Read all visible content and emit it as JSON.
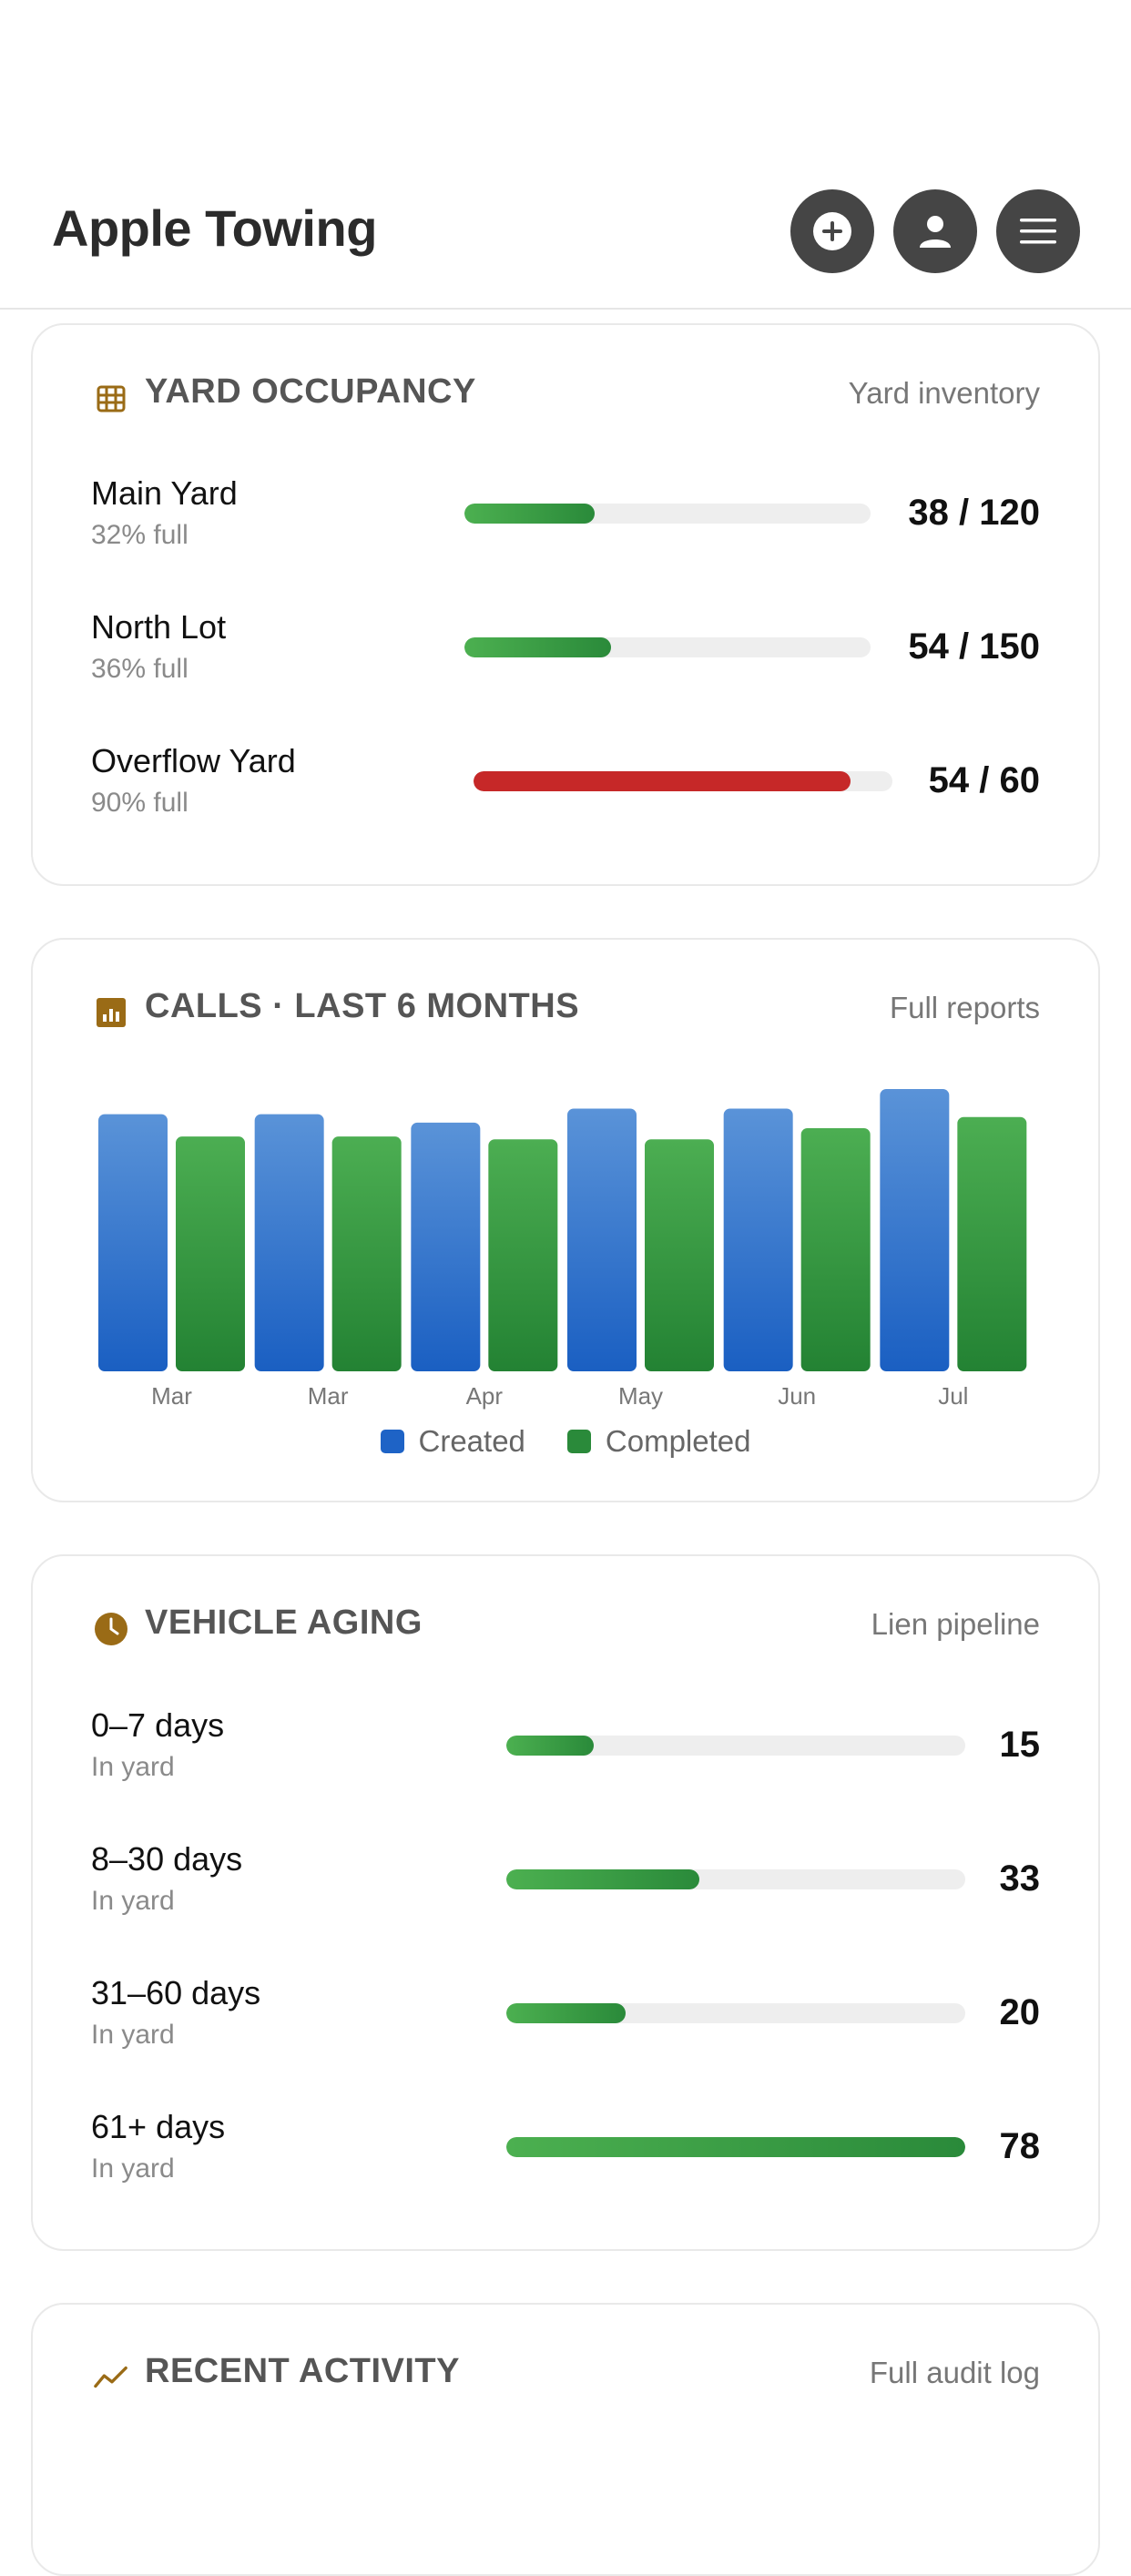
{
  "app": {
    "title": "Apple Towing"
  },
  "header": {
    "buttons": [
      {
        "name": "add-button",
        "icon": "plus-circle-icon"
      },
      {
        "name": "profile-button",
        "icon": "person-icon"
      },
      {
        "name": "menu-button",
        "icon": "hamburger-menu-icon"
      }
    ]
  },
  "yard": {
    "icon": "grid-icon",
    "title": "YARD OCCUPANCY",
    "link": "Yard inventory",
    "rows": [
      {
        "name": "Main Yard",
        "sub": "32% full",
        "value": "38 / 120",
        "fraction": 0.32,
        "status": "normal"
      },
      {
        "name": "North Lot",
        "sub": "36% full",
        "value": "54 / 150",
        "fraction": 0.36,
        "status": "normal"
      },
      {
        "name": "Overflow Yard",
        "sub": "90% full",
        "value": "54 / 60",
        "fraction": 0.9,
        "status": "danger"
      }
    ]
  },
  "calls": {
    "icon": "bar-chart-icon",
    "title": "CALLS · LAST 6 MONTHS",
    "link": "Full reports"
  },
  "chart_data": {
    "type": "bar",
    "categories": [
      "Mar",
      "Mar",
      "Apr",
      "May",
      "Jun",
      "Jul"
    ],
    "series": [
      {
        "name": "Created",
        "values": [
          92,
          92,
          89,
          94,
          94,
          101
        ],
        "color": "#1e63c6"
      },
      {
        "name": "Completed",
        "values": [
          84,
          84,
          83,
          83,
          87,
          91
        ],
        "color": "#2a8a3a"
      }
    ],
    "ylim": [
      0,
      101
    ],
    "grid": false,
    "legend": "bottom-center"
  },
  "aging": {
    "icon": "clock-icon",
    "title": "VEHICLE AGING",
    "link": "Lien pipeline",
    "rows": [
      {
        "name": "0–7 days",
        "sub": "In yard",
        "value": "15",
        "fraction": 0.19
      },
      {
        "name": "8–30 days",
        "sub": "In yard",
        "value": "33",
        "fraction": 0.42
      },
      {
        "name": "31–60 days",
        "sub": "In yard",
        "value": "20",
        "fraction": 0.26
      },
      {
        "name": "61+ days",
        "sub": "In yard",
        "value": "78",
        "fraction": 1.0
      }
    ]
  },
  "activity": {
    "icon": "trend-line-icon",
    "title": "RECENT ACTIVITY",
    "link": "Full audit log"
  },
  "colors": {
    "accent_icon": "#9a6b16",
    "header_button": "#454545",
    "bar_green": "#2a8a3a",
    "bar_blue": "#1e63c6",
    "danger": "#c62828"
  }
}
